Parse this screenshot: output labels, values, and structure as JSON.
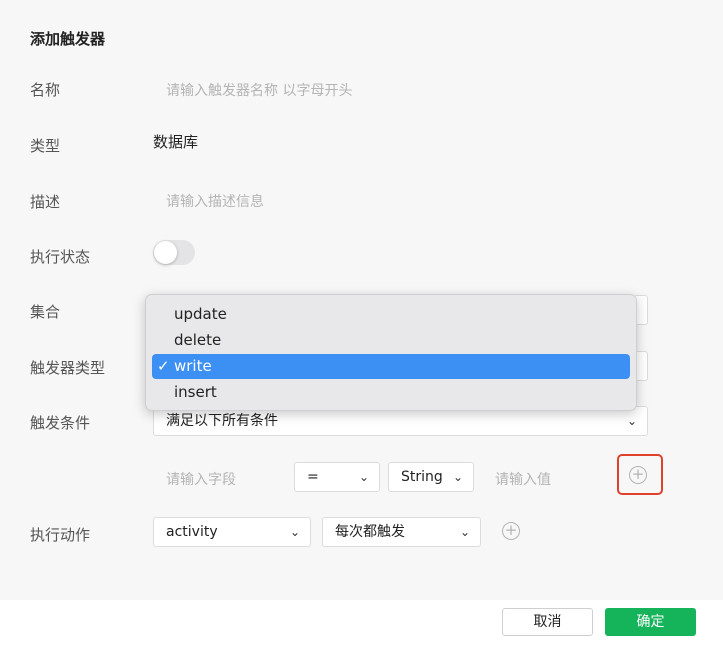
{
  "dialog": {
    "title": "添加触发器",
    "fields": {
      "name": {
        "label": "名称",
        "placeholder": "请输入触发器名称 以字母开头"
      },
      "type": {
        "label": "类型",
        "value": "数据库"
      },
      "description": {
        "label": "描述",
        "placeholder": "请输入描述信息"
      },
      "status": {
        "label": "执行状态",
        "enabled": false
      },
      "collection": {
        "label": "集合"
      },
      "trigger_type": {
        "label": "触发器类型"
      },
      "condition": {
        "label": "触发条件",
        "match_select": "满足以下所有条件",
        "field_placeholder": "请输入字段",
        "operator": "=",
        "value_type": "String",
        "value_placeholder": "请输入值"
      },
      "action": {
        "label": "执行动作",
        "action_select": "activity",
        "frequency_select": "每次都触发"
      }
    },
    "dropdown": {
      "items": [
        "update",
        "delete",
        "write",
        "insert"
      ],
      "selected_index": 2,
      "check_glyph": "✓"
    },
    "buttons": {
      "cancel": "取消",
      "ok": "确定"
    },
    "icons": {
      "chevron": "chevron-down-icon",
      "plus": "plus-circle-icon",
      "check": "checkmark-icon"
    },
    "colors": {
      "accent_green": "#16b45a",
      "menu_selected": "#3c8ff3",
      "highlight_red": "#e0412c"
    }
  }
}
